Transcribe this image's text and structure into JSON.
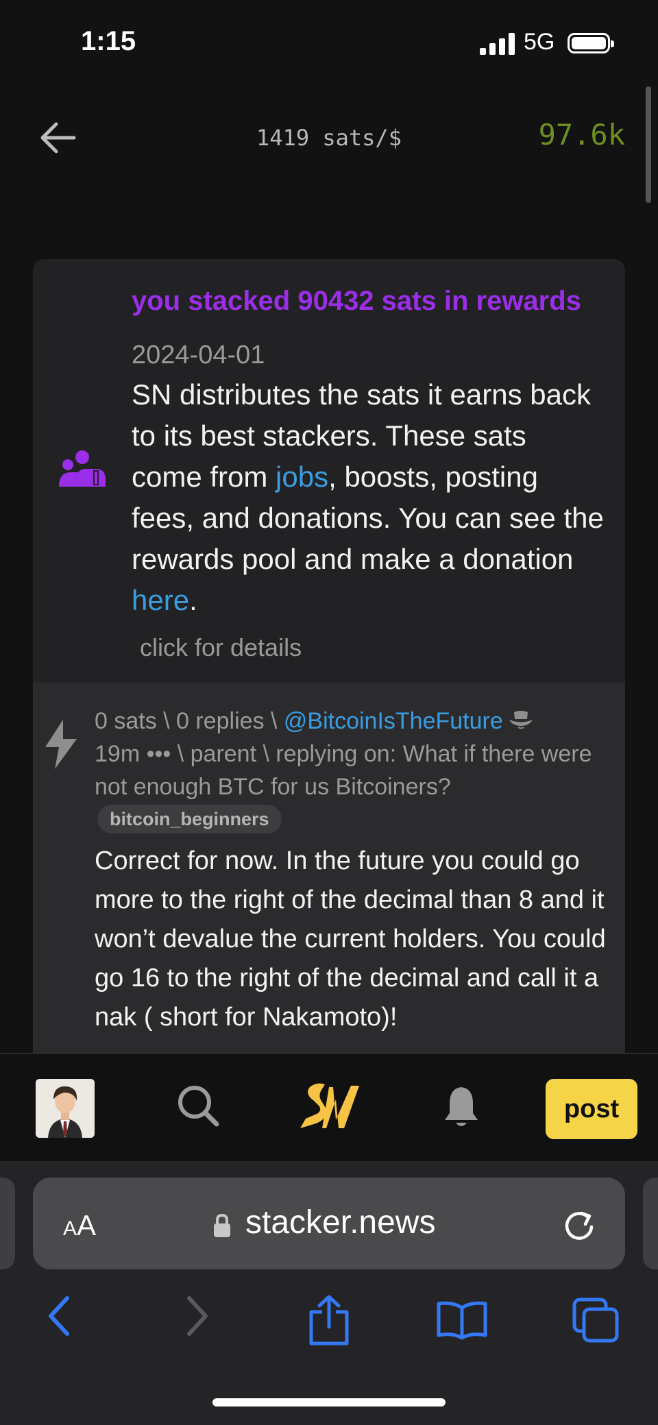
{
  "status_bar": {
    "time": "1:15",
    "network": "5G"
  },
  "header": {
    "price": "1419 sats/$",
    "balance": "97.6k"
  },
  "reward": {
    "title": "you stacked 90432 sats in rewards",
    "date": "2024-04-01",
    "body_1": "SN distributes the sats it earns back to its best stackers. These sats come from ",
    "link_jobs": "jobs",
    "body_2": ", boosts, posting fees, and donations. You can see the rewards pool and make a donation ",
    "link_here": "here",
    "body_3": ".",
    "details": "click for details"
  },
  "comment": {
    "meta_1": "0 sats \\ 0 replies \\ ",
    "author": "@BitcoinIsTheFuture",
    "meta_2": "19m ••• \\ parent \\ replying on: What if there were not enough BTC for us Bitcoiners?",
    "tag": "bitcoin_beginners",
    "text": "Correct for now. In the future you could go more to the right of the decimal than 8 and it won’t devalue the current holders. You could go 16 to the right of the decimal and call it a nak ( short for Nakamoto)!"
  },
  "nav": {
    "post_label": "post"
  },
  "browser": {
    "aa_small": "A",
    "aa_large": "A",
    "url": "stacker.news"
  },
  "colors": {
    "accent_purple": "#9b2ee8",
    "link_blue": "#3a9de0",
    "post_yellow": "#f5d547",
    "balance_green": "#6e8f22",
    "ios_blue": "#3478f6"
  },
  "icons": [
    "back-arrow-icon",
    "users-icon",
    "bolt-icon",
    "cowboy-hat-icon",
    "search-icon",
    "sn-logo-icon",
    "bell-icon",
    "lock-icon",
    "reload-icon",
    "chevron-left-icon",
    "chevron-right-icon",
    "share-icon",
    "bookmarks-icon",
    "tabs-icon"
  ]
}
